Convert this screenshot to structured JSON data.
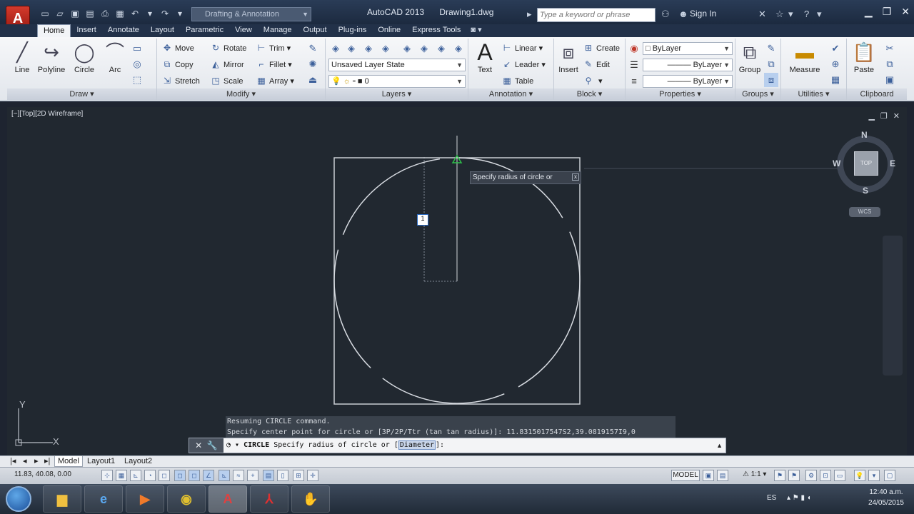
{
  "app": {
    "title": "AutoCAD 2013",
    "document": "Drawing1.dwg",
    "logo": "A",
    "workspace": "Drafting & Annotation",
    "search_placeholder": "Type a keyword or phrase",
    "signin": "Sign In"
  },
  "tabs": [
    "Home",
    "Insert",
    "Annotate",
    "Layout",
    "Parametric",
    "View",
    "Manage",
    "Output",
    "Plug-ins",
    "Online",
    "Express Tools"
  ],
  "ribbon": {
    "draw": {
      "title": "Draw",
      "line": "Line",
      "polyline": "Polyline",
      "circle": "Circle",
      "arc": "Arc"
    },
    "modify": {
      "title": "Modify",
      "move": "Move",
      "rotate": "Rotate",
      "trim": "Trim",
      "copy": "Copy",
      "mirror": "Mirror",
      "fillet": "Fillet",
      "stretch": "Stretch",
      "scale": "Scale",
      "array": "Array"
    },
    "layers": {
      "title": "Layers",
      "layer_state": "Unsaved Layer State",
      "current_layer": "0"
    },
    "annotation": {
      "title": "Annotation",
      "text": "Text",
      "linear": "Linear",
      "leader": "Leader",
      "table": "Table"
    },
    "block": {
      "title": "Block",
      "insert": "Insert",
      "create": "Create",
      "edit": "Edit"
    },
    "properties": {
      "title": "Properties",
      "color": "ByLayer",
      "linetype": "ByLayer",
      "lineweight": "ByLayer"
    },
    "groups": {
      "title": "Groups",
      "group": "Group"
    },
    "utilities": {
      "title": "Utilities",
      "measure": "Measure"
    },
    "clipboard": {
      "title": "Clipboard",
      "paste": "Paste"
    }
  },
  "viewport": {
    "label": "[−][Top][2D Wireframe]",
    "tooltip": "Specify radius of circle or",
    "dynamic_input": "1",
    "ucs_x": "X",
    "ucs_y": "Y"
  },
  "viewcube": {
    "n": "N",
    "s": "S",
    "e": "E",
    "w": "W",
    "top": "TOP",
    "wcs": "WCS"
  },
  "command": {
    "history": [
      "Resuming CIRCLE command.",
      "Specify center point for circle or [3P/2P/Ttr (tan tan radius)]: 11.8315017547S2,39.0819157I9,0"
    ],
    "current_cmd": "CIRCLE",
    "current_prompt": "Specify radius of circle or [",
    "current_option": "Diameter",
    "current_suffix": "]:"
  },
  "layout_tabs": [
    "Model",
    "Layout1",
    "Layout2"
  ],
  "status": {
    "coords": "11.83, 40.08, 0.00",
    "model": "MODEL",
    "scale": "1:1"
  },
  "taskbar": {
    "language": "ES",
    "time": "12:40 a.m.",
    "date": "24/05/2015"
  },
  "colors": {
    "accent_red": "#c4261a",
    "viewport_bg": "#212830",
    "geometry": "#d8dce2",
    "snap_marker": "#2ec24a"
  }
}
